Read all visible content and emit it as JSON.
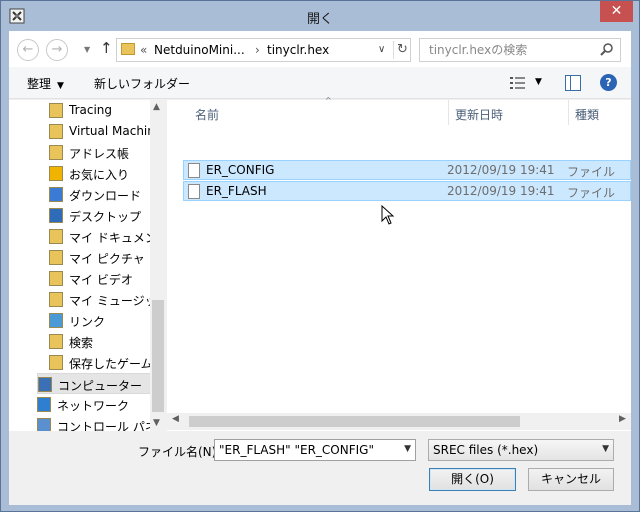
{
  "window": {
    "title": "開く",
    "close_glyph": "✕"
  },
  "nav_buttons": {
    "back_glyph": "←",
    "forward_glyph": "→",
    "up_glyph": "↑"
  },
  "address": {
    "prefix": "«",
    "crumbs": [
      "NetduinoMini...",
      "tinyclr.hex"
    ],
    "separator": "›",
    "dropdown_glyph": "∨",
    "refresh_glyph": "↻"
  },
  "search": {
    "placeholder": "tinyclr.hexの検索"
  },
  "toolbar": {
    "organize_label": "整理",
    "new_folder_label": "新しいフォルダー"
  },
  "nav_pane": {
    "items": [
      {
        "label": "Tracing",
        "icon": "folder-icon"
      },
      {
        "label": "Virtual Machin",
        "icon": "folder-icon"
      },
      {
        "label": "アドレス帳",
        "icon": "contacts-folder-icon"
      },
      {
        "label": "お気に入り",
        "icon": "favorites-folder-icon"
      },
      {
        "label": "ダウンロード",
        "icon": "downloads-folder-icon"
      },
      {
        "label": "デスクトップ",
        "icon": "desktop-folder-icon"
      },
      {
        "label": "マイ ドキュメント",
        "icon": "documents-folder-icon"
      },
      {
        "label": "マイ ピクチャ",
        "icon": "pictures-folder-icon"
      },
      {
        "label": "マイ ビデオ",
        "icon": "videos-folder-icon"
      },
      {
        "label": "マイ ミュージック",
        "icon": "music-folder-icon"
      },
      {
        "label": "リンク",
        "icon": "links-folder-icon"
      },
      {
        "label": "検索",
        "icon": "searches-folder-icon"
      },
      {
        "label": "保存したゲーム",
        "icon": "saved-games-folder-icon"
      },
      {
        "label": "コンピューター",
        "icon": "computer-icon",
        "selected": true
      },
      {
        "label": "ネットワーク",
        "icon": "network-icon"
      },
      {
        "label": "コントロール パネル",
        "icon": "control-panel-icon"
      }
    ]
  },
  "columns": {
    "name": "名前",
    "date": "更新日時",
    "type": "種類"
  },
  "files": [
    {
      "name": "ER_CONFIG",
      "date": "2012/09/19 19:41",
      "type": "ファイル"
    },
    {
      "name": "ER_FLASH",
      "date": "2012/09/19 19:41",
      "type": "ファイル"
    }
  ],
  "bottom": {
    "filename_label": "ファイル名(N):",
    "filename_value": "\"ER_FLASH\" \"ER_CONFIG\"",
    "filetype_value": "SREC files (*.hex)",
    "open_label": "開く(O)",
    "cancel_label": "キャンセル"
  },
  "colors": {
    "accent": "#3c7fb1",
    "selection": "#cce8ff",
    "selection_border": "#99d1ff",
    "close": "#c75050"
  }
}
